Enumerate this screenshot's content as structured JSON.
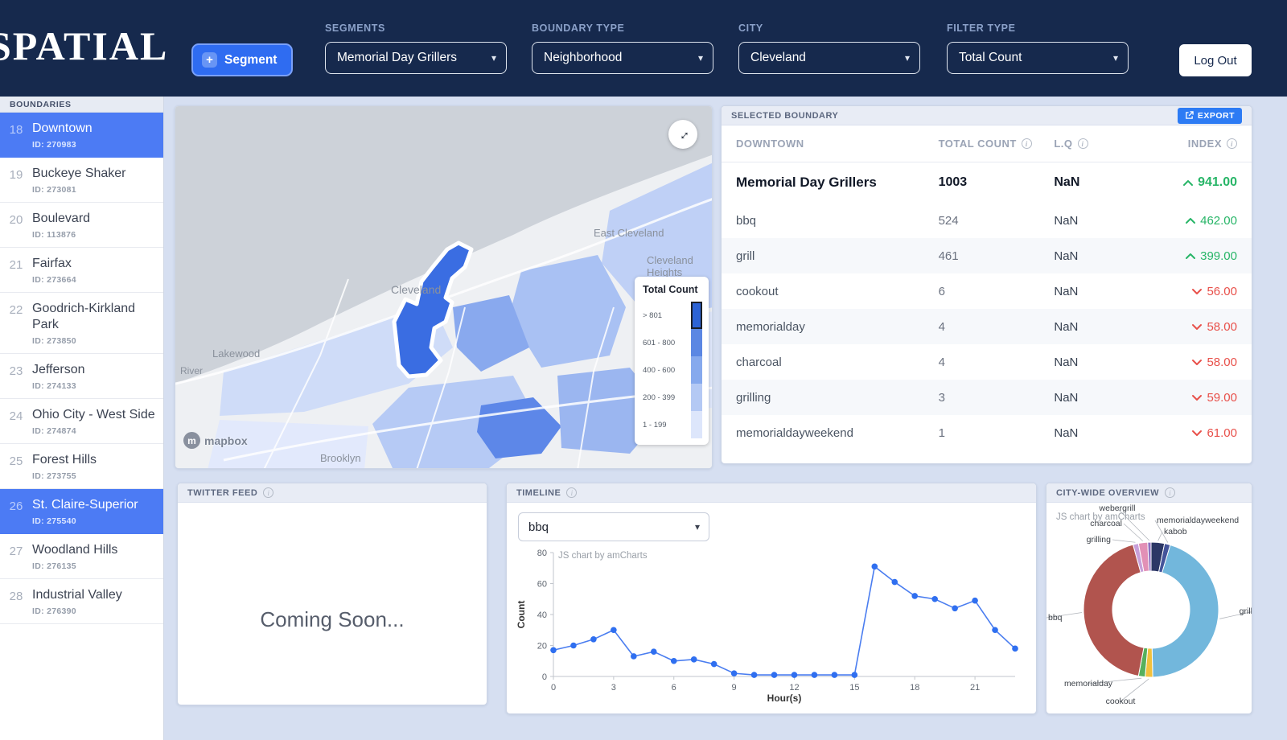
{
  "icons": {
    "plus": "+",
    "chevron_down": "▾",
    "expand": "↔",
    "info": "i",
    "mapbox_m": "m"
  },
  "colors": {
    "navy": "#16294d",
    "accent_blue": "#2f6cf1",
    "selected_blue": "#4c7bf4",
    "up_green": "#27b567",
    "down_red": "#e8504a"
  },
  "topbar": {
    "logo": "SPATIAL",
    "segment_button": "Segment",
    "dropdowns": {
      "segments": {
        "label": "SEGMENTS",
        "value": "Memorial Day Grillers"
      },
      "boundary_type": {
        "label": "BOUNDARY TYPE",
        "value": "Neighborhood"
      },
      "city": {
        "label": "CITY",
        "value": "Cleveland"
      },
      "filter_type": {
        "label": "FILTER TYPE",
        "value": "Total Count"
      }
    },
    "logout": "Log Out"
  },
  "sidebar": {
    "title": "BOUNDARIES",
    "items": [
      {
        "num": "18",
        "name": "Downtown",
        "id": "ID: 270983",
        "selected": true
      },
      {
        "num": "19",
        "name": "Buckeye Shaker",
        "id": "ID: 273081",
        "selected": false
      },
      {
        "num": "20",
        "name": "Boulevard",
        "id": "ID: 113876",
        "selected": false
      },
      {
        "num": "21",
        "name": "Fairfax",
        "id": "ID: 273664",
        "selected": false
      },
      {
        "num": "22",
        "name": "Goodrich-Kirkland Park",
        "id": "ID: 273850",
        "selected": false
      },
      {
        "num": "23",
        "name": "Jefferson",
        "id": "ID: 274133",
        "selected": false
      },
      {
        "num": "24",
        "name": "Ohio City - West Side",
        "id": "ID: 274874",
        "selected": false
      },
      {
        "num": "25",
        "name": "Forest Hills",
        "id": "ID: 273755",
        "selected": false
      },
      {
        "num": "26",
        "name": "St. Claire-Superior",
        "id": "ID: 275540",
        "selected": true
      },
      {
        "num": "27",
        "name": "Woodland Hills",
        "id": "ID: 276135",
        "selected": false
      },
      {
        "num": "28",
        "name": "Industrial Valley",
        "id": "ID: 276390",
        "selected": false
      }
    ]
  },
  "map": {
    "legend_title": "Total Count",
    "legend": [
      {
        "label": "> 801",
        "color": "#2c63d5",
        "selected": true
      },
      {
        "label": "601 - 800",
        "color": "#5b87e3",
        "selected": false
      },
      {
        "label": "400 - 600",
        "color": "#86a9ed",
        "selected": false
      },
      {
        "label": "200 - 399",
        "color": "#b4c9f4",
        "selected": false
      },
      {
        "label": "1 - 199",
        "color": "#dde6fb",
        "selected": false
      }
    ],
    "labels": [
      "East Cleveland",
      "Cleveland",
      "Cleveland Heights",
      "Lakewood",
      "Brooklyn",
      "River"
    ],
    "attribution": "mapbox"
  },
  "boundary_panel": {
    "title": "SELECTED BOUNDARY",
    "export_label": "EXPORT",
    "columns": [
      "DOWNTOWN",
      "TOTAL COUNT",
      "L.Q",
      "INDEX"
    ],
    "rows": [
      {
        "term": "Memorial Day Grillers",
        "count": "1003",
        "lq": "NaN",
        "index": "941.00",
        "dir": "up",
        "strong": true
      },
      {
        "term": "bbq",
        "count": "524",
        "lq": "NaN",
        "index": "462.00",
        "dir": "up",
        "strong": false
      },
      {
        "term": "grill",
        "count": "461",
        "lq": "NaN",
        "index": "399.00",
        "dir": "up",
        "strong": false
      },
      {
        "term": "cookout",
        "count": "6",
        "lq": "NaN",
        "index": "56.00",
        "dir": "down",
        "strong": false
      },
      {
        "term": "memorialday",
        "count": "4",
        "lq": "NaN",
        "index": "58.00",
        "dir": "down",
        "strong": false
      },
      {
        "term": "charcoal",
        "count": "4",
        "lq": "NaN",
        "index": "58.00",
        "dir": "down",
        "strong": false
      },
      {
        "term": "grilling",
        "count": "3",
        "lq": "NaN",
        "index": "59.00",
        "dir": "down",
        "strong": false
      },
      {
        "term": "memorialdayweekend",
        "count": "1",
        "lq": "NaN",
        "index": "61.00",
        "dir": "down",
        "strong": false
      }
    ]
  },
  "panels": {
    "twitter": {
      "title": "TWITTER FEED",
      "message": "Coming Soon..."
    },
    "timeline": {
      "title": "TIMELINE"
    },
    "citywide": {
      "title": "CITY-WIDE OVERVIEW"
    }
  },
  "chart_data": [
    {
      "type": "line",
      "panel_title": "TIMELINE",
      "selected_term": "bbq",
      "x": [
        0,
        1,
        2,
        3,
        4,
        5,
        6,
        7,
        8,
        9,
        10,
        11,
        12,
        13,
        14,
        15,
        16,
        17,
        18,
        19,
        20,
        21,
        22,
        23
      ],
      "y": [
        17,
        20,
        24,
        30,
        13,
        16,
        10,
        11,
        8,
        2,
        1,
        1,
        1,
        1,
        1,
        1,
        71,
        61,
        52,
        50,
        44,
        49,
        30,
        18
      ],
      "xticks": [
        0,
        3,
        6,
        9,
        12,
        15,
        18,
        21
      ],
      "yticks": [
        0,
        20,
        40,
        60,
        80
      ],
      "ylim": [
        0,
        80
      ],
      "xlabel": "Hour(s)",
      "ylabel": "Count",
      "line_color": "#4a7df0",
      "watermark": "JS chart by amCharts"
    },
    {
      "type": "pie",
      "panel_title": "CITY-WIDE OVERVIEW",
      "watermark": "JS chart by amCharts",
      "slices": [
        {
          "label": "kabob",
          "value": 3.2,
          "color": "#2c3766"
        },
        {
          "label": "memorialdayweekend",
          "value": 1.4,
          "color": "#44549a"
        },
        {
          "label": "grill",
          "value": 45.0,
          "color": "#72b7dc"
        },
        {
          "label": "cookout",
          "value": 1.8,
          "color": "#f2c13d"
        },
        {
          "label": "memorialday",
          "value": 1.6,
          "color": "#57b05c"
        },
        {
          "label": "bbq",
          "value": 42.7,
          "color": "#b1544e"
        },
        {
          "label": "grilling",
          "value": 1.3,
          "color": "#c79fd9"
        },
        {
          "label": "charcoal",
          "value": 2.2,
          "color": "#e290b6"
        },
        {
          "label": "webergrill",
          "value": 0.8,
          "color": "#8d6fc0"
        }
      ]
    }
  ]
}
